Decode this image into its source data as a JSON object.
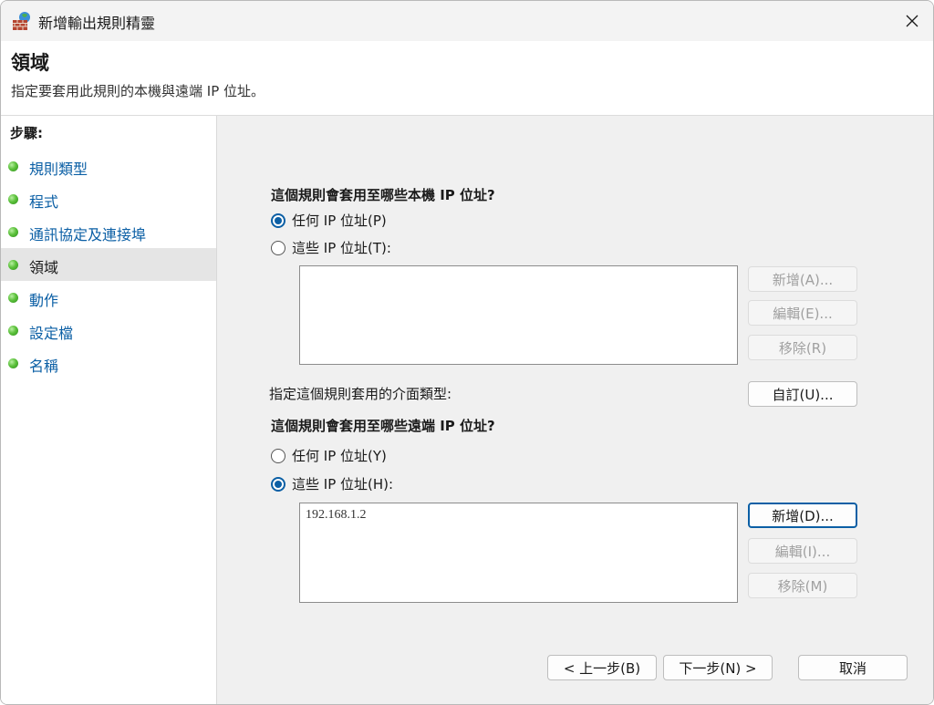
{
  "window": {
    "title": "新增輸出規則精靈",
    "icon": "firewall-wall-icon",
    "close_icon": "close-icon"
  },
  "header": {
    "title": "領域",
    "subtitle": "指定要套用此規則的本機與遠端 IP 位址。"
  },
  "sidebar": {
    "heading": "步驟:",
    "items": [
      {
        "label": "規則類型",
        "current": false
      },
      {
        "label": "程式",
        "current": false
      },
      {
        "label": "通訊協定及連接埠",
        "current": false
      },
      {
        "label": "領域",
        "current": true
      },
      {
        "label": "動作",
        "current": false
      },
      {
        "label": "設定檔",
        "current": false
      },
      {
        "label": "名稱",
        "current": false
      }
    ]
  },
  "local": {
    "question": "這個規則會套用至哪些本機 IP 位址?",
    "option_any": "任何 IP 位址(P)",
    "option_these": "這些 IP 位址(T):",
    "selected": "any",
    "entries": [],
    "add_label": "新增(A)...",
    "edit_label": "編輯(E)...",
    "remove_label": "移除(R)"
  },
  "interface": {
    "label": "指定這個規則套用的介面類型:",
    "customize_label": "自訂(U)..."
  },
  "remote": {
    "question": "這個規則會套用至哪些遠端 IP 位址?",
    "option_any": "任何 IP 位址(Y)",
    "option_these": "這些 IP 位址(H):",
    "selected": "these",
    "entries": [
      "192.168.1.2"
    ],
    "add_label": "新增(D)...",
    "edit_label": "編輯(I)...",
    "remove_label": "移除(M)"
  },
  "footer": {
    "back_label": "< 上一步(B)",
    "next_label": "下一步(N) >",
    "cancel_label": "取消"
  },
  "colors": {
    "accent": "#0b5fa5",
    "link": "#0b5fa5",
    "panel_bg": "#f0f0f0",
    "current_step_bg": "#e5e5e5"
  }
}
